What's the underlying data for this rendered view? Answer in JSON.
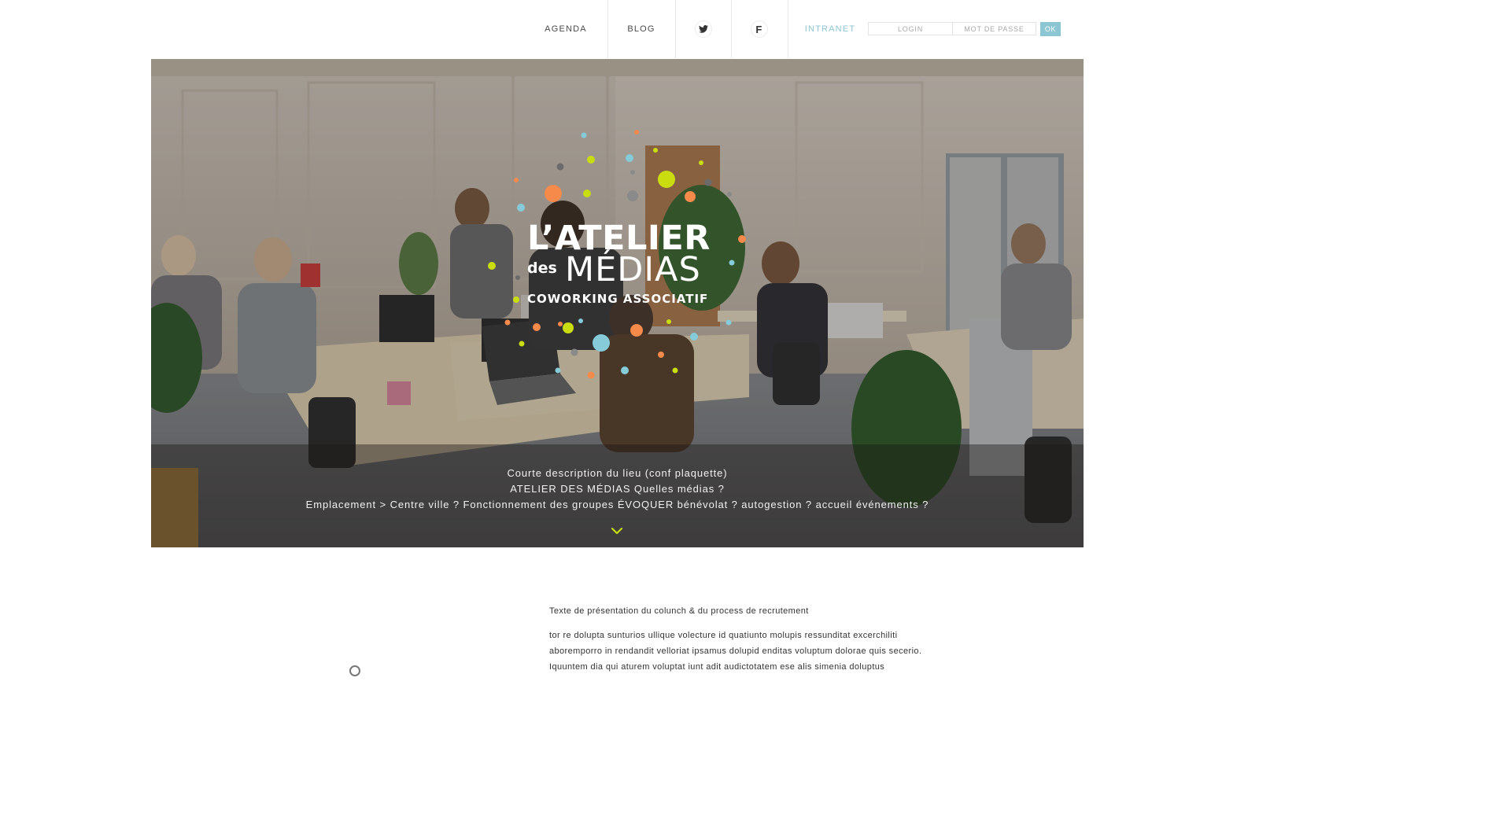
{
  "nav": {
    "agenda": "AGENDA",
    "blog": "BLOG",
    "twitter_icon": "twitter-icon",
    "facebook_icon": "facebook-icon",
    "facebook_glyph": "f",
    "intranet": "INTRANET"
  },
  "login": {
    "login_placeholder": "LOGIN",
    "password_placeholder": "MOT DE PASSE",
    "ok_label": "OK"
  },
  "hero": {
    "logo": {
      "line1": "L’ATELIER",
      "des": "des",
      "medias": "MÉDIAS",
      "tagline": "COWORKING ASSOCIATIF"
    },
    "lines": [
      "Courte description du lieu (conf plaquette)",
      "ATELIER DES MÉDIAS Quelles médias ?",
      "Emplacement > Centre ville ?  Fonctionnement des groupes ÉVOQUER bénévolat ? autogestion ? accueil événements ?"
    ],
    "scroll_icon": "chevron-down-icon"
  },
  "content": {
    "title": "Texte de présentation du colunch & du process de recrutement",
    "paragraph": [
      "tor re dolupta sunturios ullique volecture id quatiunto molupis ressunditat excerchiliti",
      "aboremporro in rendandit velloriat ipsamus dolupid enditas voluptum dolorae quis secerio.",
      "Iquuntem dia qui aturem voluptat iunt adit audictotatem ese alis simenia doluptus"
    ]
  },
  "colors": {
    "accent_blue": "#8cc6d3",
    "dot_orange": "#f58a4b",
    "dot_lime": "#c9dd0f",
    "dot_blue": "#86cbd9",
    "dot_grey": "#8a8a8a"
  }
}
